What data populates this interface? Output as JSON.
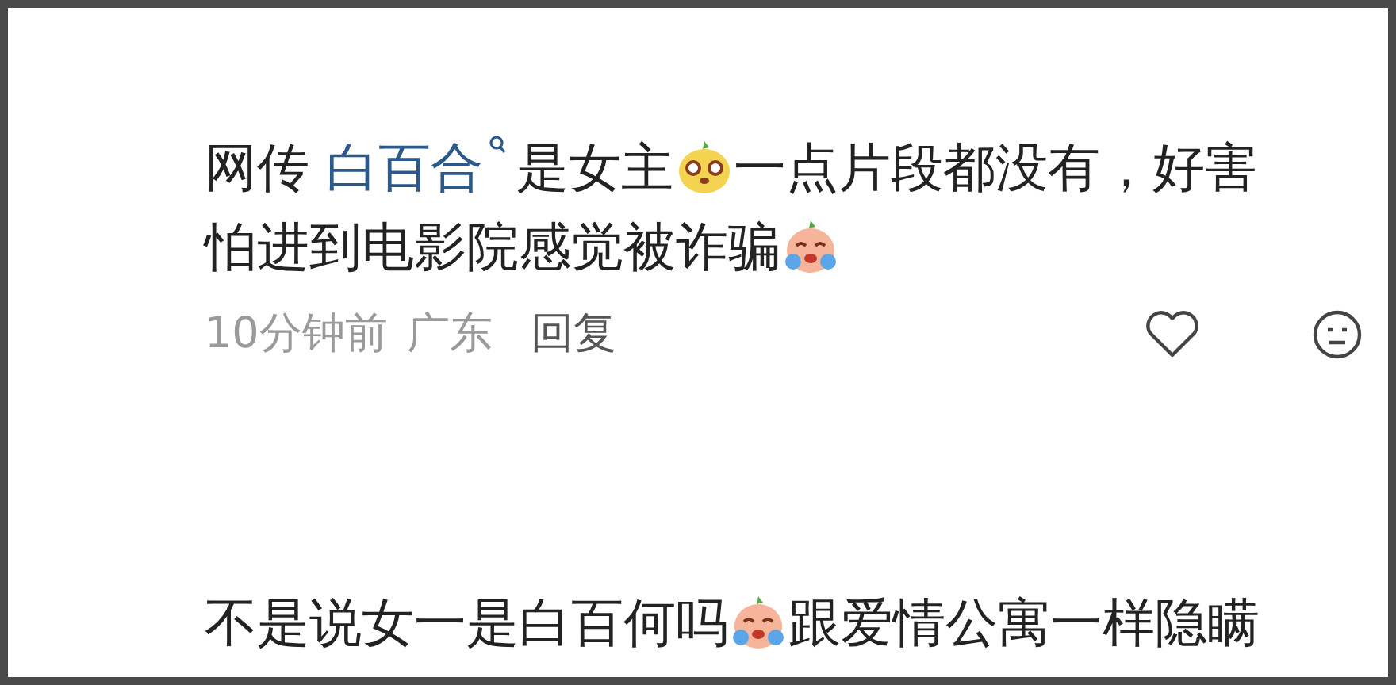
{
  "comments": [
    {
      "lines": [
        [
          {
            "kind": "text",
            "text": "网传 "
          },
          {
            "kind": "mention",
            "text": "白百合"
          },
          {
            "kind": "text",
            "text": "是女主"
          },
          {
            "kind": "happy_emoji"
          },
          {
            "kind": "text",
            "text": "一点片段都没有，好害"
          }
        ],
        [
          {
            "kind": "text",
            "text": "怕进到电影院感觉被诈骗"
          },
          {
            "kind": "crying_emoji"
          }
        ]
      ],
      "meta": {
        "time": "10分钟前",
        "location": "广东",
        "reply": "回复"
      }
    },
    {
      "lines": [
        [
          {
            "kind": "text",
            "text": "不是说女一是白百何吗"
          },
          {
            "kind": "crying_emoji"
          },
          {
            "kind": "text",
            "text": "跟爱情公寓一样隐瞒"
          }
        ]
      ]
    }
  ]
}
